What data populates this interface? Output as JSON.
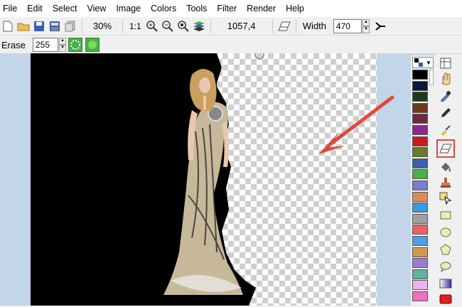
{
  "menu": [
    "File",
    "Edit",
    "Select",
    "View",
    "Image",
    "Colors",
    "Tools",
    "Filter",
    "Render",
    "Help"
  ],
  "toolbar": {
    "zoom": "30%",
    "actual_size": "1:1",
    "coords": "1057,4",
    "width_label": "Width",
    "width_value": "470"
  },
  "toolbar2": {
    "erase_label": "Erase",
    "erase_value": "255"
  },
  "palette": [
    "#000000",
    "#0d1a3c",
    "#1e3a1e",
    "#6b3a1a",
    "#6e2a45",
    "#8a2a8a",
    "#cc1a1a",
    "#6a7a2a",
    "#3a5fae",
    "#4ab04a",
    "#7a7ad0",
    "#e08a5a",
    "#3a9ae0",
    "#a0a0a0",
    "#f06060",
    "#4aa0e0",
    "#d09a50",
    "#a07ad0",
    "#60b0a0",
    "#f0b0f0",
    "#f070c0"
  ],
  "colors": {
    "accent": "#e04a3a",
    "selected_tool_border": "#e04a3a"
  },
  "icons": [
    "new-icon",
    "open-icon",
    "save-icon",
    "print-icon",
    "copy-icon",
    "zoom-in-icon",
    "zoom-out-icon",
    "zoom-fit-icon",
    "layers-icon",
    "eraser-icon",
    "arrow-icon",
    "transparency-icon",
    "green-mode-icon",
    "hand-icon",
    "eyedropper-icon",
    "pencil-icon",
    "brush-icon",
    "eraser-tool-icon",
    "fill-icon",
    "stamp-icon",
    "select-icon",
    "rect-icon",
    "ellipse-icon",
    "polygon-icon",
    "speech-icon",
    "gradient-icon",
    "red-rect-icon"
  ]
}
